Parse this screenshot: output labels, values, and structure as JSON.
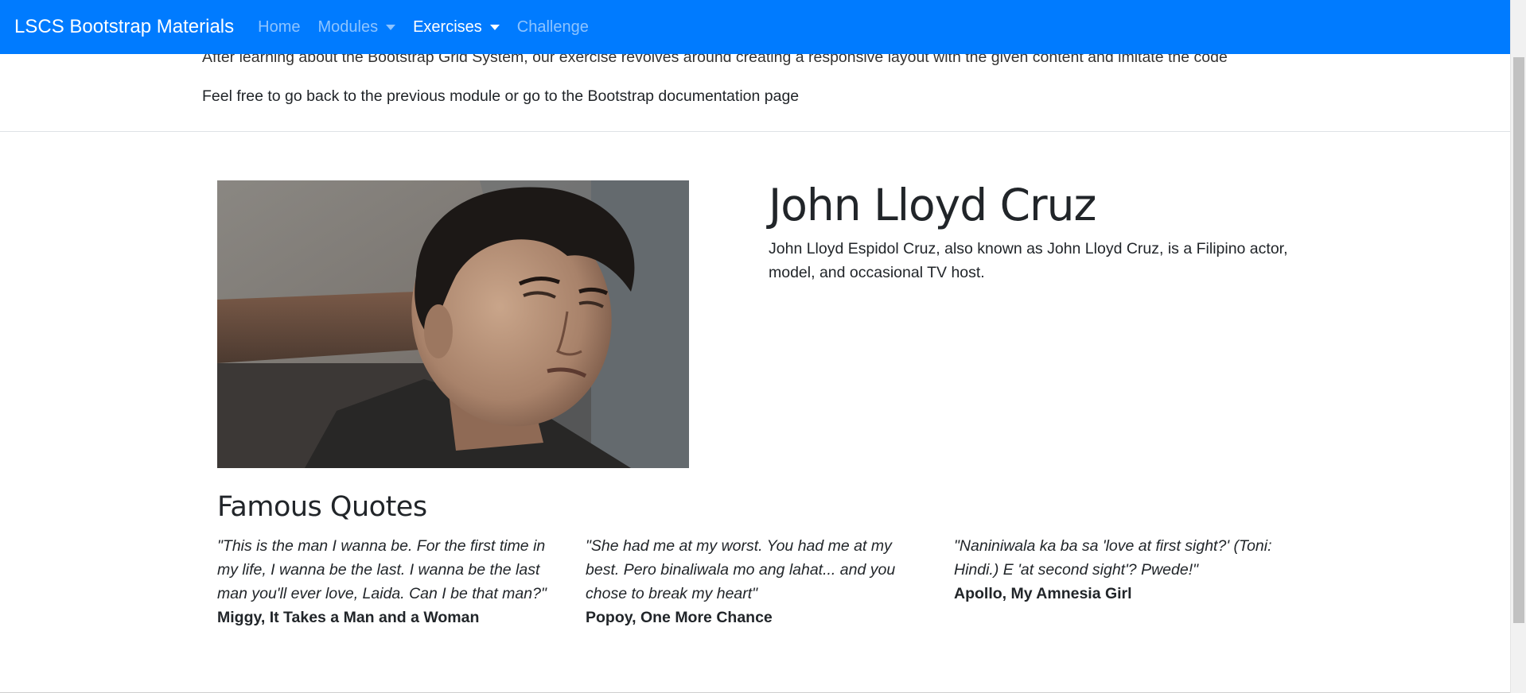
{
  "navbar": {
    "brand": "LSCS Bootstrap Materials",
    "items": [
      {
        "label": "Home"
      },
      {
        "label": "Modules"
      },
      {
        "label": "Exercises"
      },
      {
        "label": "Challenge"
      }
    ],
    "bg_color": "#007bff"
  },
  "intro": {
    "line1": "After learning about the Bootstrap Grid System, our exercise revolves around creating a responsive layout with the given content and imitate the code",
    "line2": "Feel free to go back to the previous module or go to the Bootstrap documentation page"
  },
  "profile": {
    "name": "John Lloyd Cruz",
    "description": "John Lloyd Espidol Cruz, also known as John Lloyd Cruz, is a Filipino actor, model, and occasional TV host."
  },
  "quotes": {
    "heading": "Famous Quotes",
    "items": [
      {
        "text": "\"This is the man I wanna be. For the first time in my life, I wanna be the last. I wanna be the last man you'll ever love, Laida. Can I be that man?\"",
        "source": "Miggy, It Takes a Man and a Woman"
      },
      {
        "text": "\"She had me at my worst. You had me at my best. Pero binaliwala mo ang lahat... and you chose to break my heart\"",
        "source": "Popoy, One More Chance"
      },
      {
        "text": "\"Naniniwala ka ba sa 'love at first sight?' (Toni: Hindi.) E 'at second sight'? Pwede!\"",
        "source": "Apollo, My Amnesia Girl"
      }
    ]
  }
}
